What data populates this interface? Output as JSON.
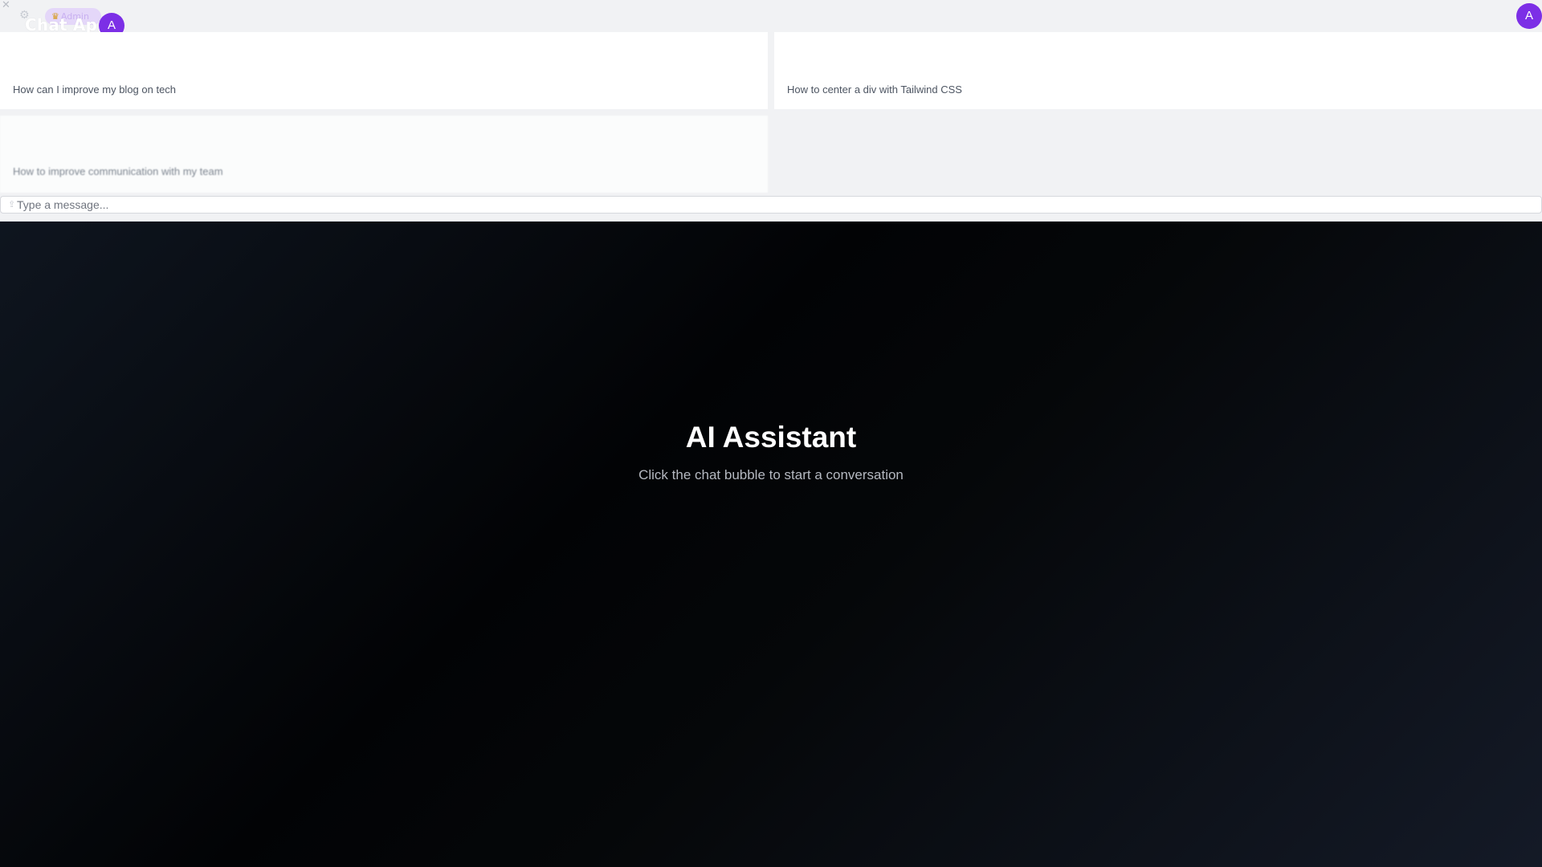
{
  "header": {
    "app_title": "Chat App",
    "role_badge": "Admin",
    "badge_icon": "crown-icon",
    "avatar_initial_left": "A",
    "avatar_initial_right": "A",
    "close_glyph": "✕",
    "settings_glyph": "⚙"
  },
  "suggestions": [
    {
      "text": "How can I improve my blog on tech"
    },
    {
      "text": "How to center a div with Tailwind CSS"
    },
    {
      "text": "How to improve communication with my team"
    },
    {
      "text": ""
    }
  ],
  "composer": {
    "placeholder": "Type a message...",
    "attach_glyph": "⇪"
  },
  "hero": {
    "title": "AI Assistant",
    "subtitle": "Click the chat bubble to start a conversation"
  },
  "colors": {
    "accent": "#7c2fe6",
    "badge_bg": "#e4d7f9",
    "panel_bg": "#f1f2f4",
    "page_bg_dark": "#020305"
  }
}
